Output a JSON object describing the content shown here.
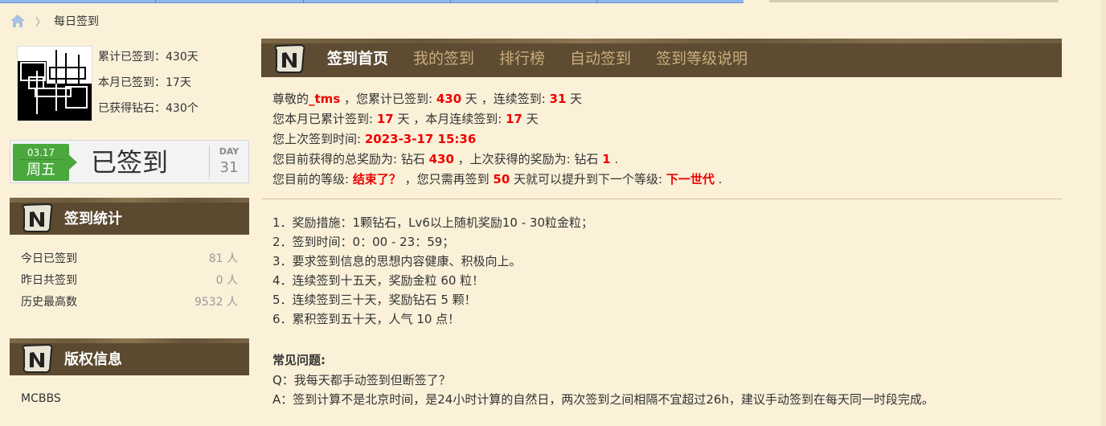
{
  "breadcrumb": {
    "current": "每日签到"
  },
  "user": {
    "total_label": "累计已签到：430天",
    "month_label": "本月已签到：17天",
    "diamond_label": "已获得钻石：430个"
  },
  "sign_card": {
    "date": "03.17",
    "weekday": "周五",
    "status": "已签到",
    "day_label": "DAY",
    "day_num": "31"
  },
  "sidebar": {
    "stats_title": "签到统计",
    "stats": [
      {
        "label": "今日已签到",
        "value": "81 人"
      },
      {
        "label": "昨日共签到",
        "value": "0 人"
      },
      {
        "label": "历史最高数",
        "value": "9532 人"
      }
    ],
    "copyright_title": "版权信息",
    "copyright_text": "MCBBS"
  },
  "nav": {
    "tabs": [
      {
        "label": "签到首页",
        "active": true
      },
      {
        "label": "我的签到"
      },
      {
        "label": "排行榜"
      },
      {
        "label": "自动签到"
      },
      {
        "label": "签到等级说明"
      }
    ]
  },
  "info": {
    "l1_pre": "尊敬的",
    "username": "_tms",
    "l1_mid": " ，您累计已签到: ",
    "total_days": "430",
    "l1_mid2": " 天 ，连续签到: ",
    "streak": "31",
    "l1_end": " 天",
    "l2_pre": "您本月已累计签到: ",
    "month_days": "17",
    "l2_mid": " 天 ，本月连续签到: ",
    "month_streak": "17",
    "l2_end": " 天",
    "l3_pre": "您上次签到时间: ",
    "last_time": "2023-3-17 15:36",
    "l4_pre": "您目前获得的总奖励为: 钻石 ",
    "total_reward": "430",
    "l4_mid": " ，上次获得的奖励为: 钻石 ",
    "last_reward": "1",
    "l4_end": " .",
    "l5_pre": "您目前的等级: ",
    "level": "结束了？",
    "l5_mid": " ，您只需再签到 ",
    "need_days": "50",
    "l5_mid2": " 天就可以提升到下一个等级: ",
    "next_level": "下一世代",
    "l5_end": " ."
  },
  "rules": [
    "1．奖励措施：1颗钻石，Lv6以上随机奖励10 - 30粒金粒；",
    "2．签到时间：0：00 - 23：59；",
    "3．要求签到信息的思想内容健康、积极向上。",
    "4．连续签到十五天，奖励金粒 60 粒！",
    "5．连续签到三十天，奖励钻石 5 颗！",
    "6．累积签到五十天，人气 10 点！"
  ],
  "faq": {
    "title": "常见问题:",
    "q": "Q：我每天都手动签到但断签了？",
    "a": "A：签到计算不是北京时间，是24小时计算的自然日，两次签到之间相隔不宜超过26h，建议手动签到在每天同一时段完成。"
  },
  "colors": {
    "accent_red": "#e00000",
    "header_brown": "#5d4b32",
    "sign_green": "#4aa83d",
    "page_bg": "#fbf1d9"
  }
}
